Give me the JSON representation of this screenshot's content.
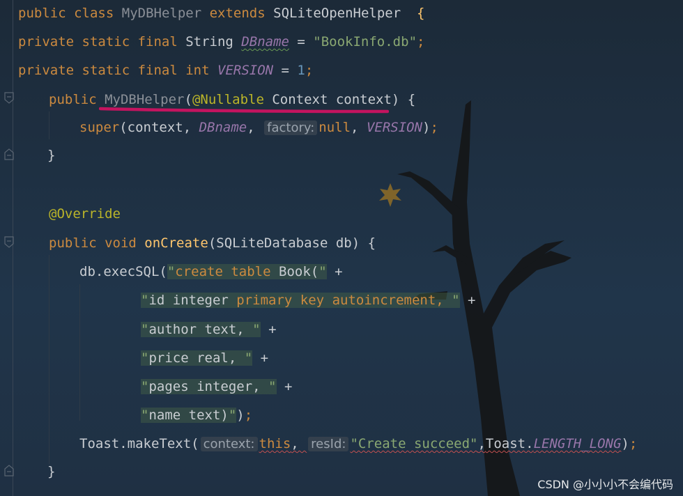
{
  "code": {
    "line1": {
      "public": "public",
      "class": "class",
      "name": "MyDBHelper",
      "extends": "extends",
      "parent": "SQLiteOpenHelper",
      "brace": "{"
    },
    "line2": {
      "mods": "private static final",
      "type": "String",
      "field": "DBname",
      "eq": " = ",
      "value": "\"BookInfo.db\"",
      "semi": ";"
    },
    "line3": {
      "mods": "private static final",
      "type": "int",
      "field": "VERSION",
      "eq": " = ",
      "value": "1",
      "semi": ";"
    },
    "line4": {
      "public": "public",
      "name": "MyDBHelper",
      "open": "(",
      "annotation": "@Nullable",
      "params": " Context context) {"
    },
    "line5": {
      "super": "super",
      "args1": "(context, ",
      "field": "DBname",
      "comma": ", ",
      "hint": "factory:",
      "null": "null",
      "comma2": ", ",
      "field2": "VERSION",
      "close": ")",
      "semi": ";"
    },
    "line6": {
      "brace": "}"
    },
    "line7": {
      "annotation": "@Override"
    },
    "line8": {
      "mods": "public void",
      "method": "onCreate",
      "params": "(SQLiteDatabase db) {"
    },
    "line9": {
      "call": "db.execSQL(",
      "q": "\"",
      "sql_kw": "create table",
      "sql_rest": " Book(",
      "q2": "\"",
      "plus": " +"
    },
    "line10": {
      "q": "\"",
      "col": "id integer ",
      "kw": "primary key autoincrement, ",
      "q2": "\"",
      "plus": " +"
    },
    "line11": {
      "q": "\"",
      "col": "author text, ",
      "q2": "\"",
      "plus": " +"
    },
    "line12": {
      "q": "\"",
      "col": "price real, ",
      "q2": "\"",
      "plus": " +"
    },
    "line13": {
      "q": "\"",
      "col": "pages integer, ",
      "q2": "\"",
      "plus": " +"
    },
    "line14": {
      "q": "\"",
      "col": "name text)",
      "q2": "\"",
      "close": ")",
      "semi": ";"
    },
    "line15": {
      "call": "Toast.makeText(",
      "hint1": "context:",
      "this": "this",
      "comma": ", ",
      "hint2": "resId:",
      "str": "\"Create succeed\"",
      "comma2": ",",
      "toast": "Toast.",
      "field": "LENGTH_LONG",
      "close": ")",
      "semi": ";"
    },
    "line16": {
      "brace": "}"
    }
  },
  "watermark": "CSDN @小小小不会编代码",
  "colors": {
    "keyword": "#cc8a3f",
    "string": "#8aa872",
    "field": "#9876aa",
    "annotation": "#bbb529",
    "markup": "#c4145f"
  }
}
